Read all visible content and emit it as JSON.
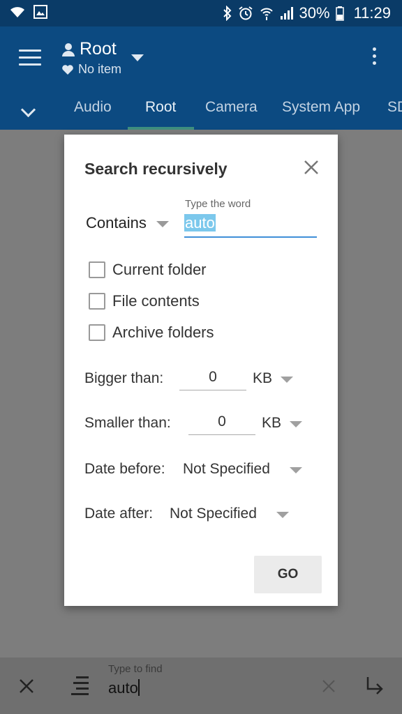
{
  "status_bar": {
    "battery": "30%",
    "time": "11:29",
    "icons": [
      "wifi-icon",
      "image-icon",
      "bluetooth-icon",
      "alarm-icon",
      "wifi-calling-icon",
      "signal-icon",
      "battery-icon"
    ]
  },
  "app_bar": {
    "title": "Root",
    "subtitle": "No item",
    "tabs": [
      "Audio",
      "Root",
      "Camera",
      "System App",
      "SD"
    ],
    "active_tab": "Root"
  },
  "dialog": {
    "title": "Search recursively",
    "match_mode": "Contains",
    "word_label": "Type the word",
    "word_value": "auto",
    "options": [
      {
        "label": "Current folder",
        "checked": false
      },
      {
        "label": "File contents",
        "checked": false
      },
      {
        "label": "Archive folders",
        "checked": false
      }
    ],
    "bigger_than": {
      "label": "Bigger than:",
      "value": "0",
      "unit": "KB"
    },
    "smaller_than": {
      "label": "Smaller than:",
      "value": "0",
      "unit": "KB"
    },
    "date_before": {
      "label": "Date before:",
      "value": "Not Specified"
    },
    "date_after": {
      "label": "Date after:",
      "value": "Not Specified"
    },
    "go_label": "GO"
  },
  "bottom_bar": {
    "find_label": "Type to find",
    "find_value": "auto"
  },
  "colors": {
    "status_bar": "#0a3b67",
    "app_bar": "#0c4a81",
    "tab_indicator": "#3f8f7f",
    "input_underline": "#3f8fd8",
    "selection": "#7cc8ec"
  }
}
